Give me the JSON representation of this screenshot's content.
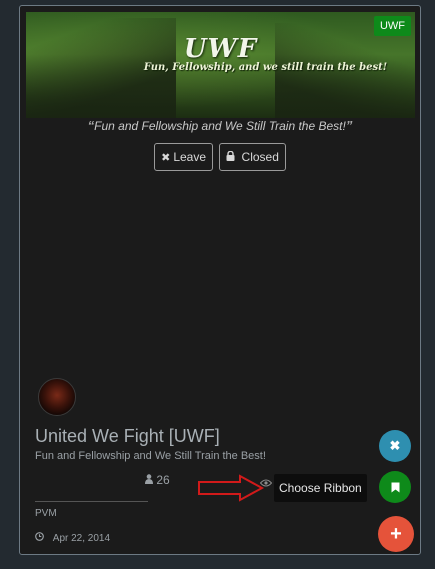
{
  "banner": {
    "logo": "UWF",
    "tagline": "Fun, Fellowship, and we still train the best!",
    "badge": "UWF"
  },
  "quote": "Fun and Fellowship and We Still Train the Best!",
  "actions": {
    "leave_label": "Leave",
    "closed_label": "Closed"
  },
  "club": {
    "title": "United We Fight [UWF]",
    "description": "Fun and Fellowship and We Still Train the Best!",
    "member_count": "26",
    "tag": "PVM",
    "date": "Apr 22, 2014"
  },
  "tooltip": "Choose Ribbon",
  "icons": {
    "leave": "close-icon",
    "closed": "lock-icon",
    "members": "user-icon",
    "date": "clock-icon",
    "eye": "eye-icon",
    "fab_close": "close-icon",
    "fab_ribbon": "bookmark-icon",
    "fab_add": "plus-icon"
  },
  "colors": {
    "badge": "#0e8a1a",
    "fab_blue": "#2e8fb0",
    "fab_green": "#0e8a1a",
    "fab_red": "#e5533a",
    "arrow": "#d11a1a"
  }
}
